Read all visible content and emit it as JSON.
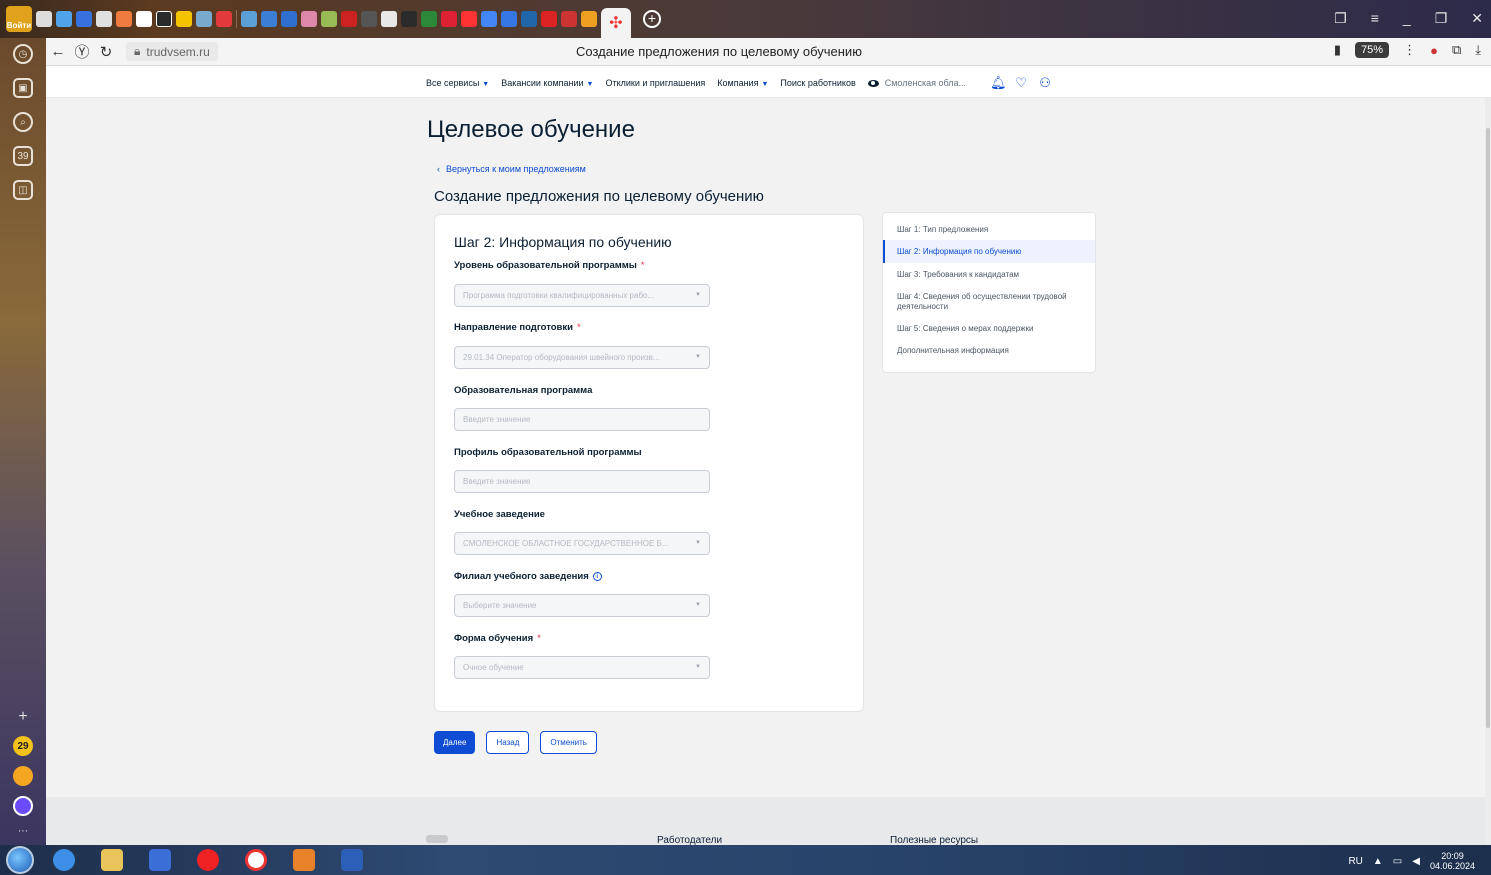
{
  "browser": {
    "login_label": "Войти",
    "url": "trudvsem.ru",
    "page_title": "Создание предложения по целевому обучению",
    "zoom": "75%"
  },
  "header": {
    "nav": [
      {
        "label": "Все сервисы",
        "dropdown": true
      },
      {
        "label": "Вакансии компании",
        "dropdown": true
      },
      {
        "label": "Отклики и приглашения",
        "dropdown": false
      },
      {
        "label": "Компания",
        "dropdown": true
      },
      {
        "label": "Поиск работников",
        "dropdown": false
      }
    ],
    "region": "Смоленская обла..."
  },
  "page": {
    "title": "Целевое обучение",
    "back_link": "Вернуться к моим предложениям",
    "subtitle": "Создание предложения по целевому обучению"
  },
  "form": {
    "step_title": "Шаг 2: Информация по обучению",
    "fields": [
      {
        "label": "Уровень образовательной программы",
        "required": true,
        "info": false,
        "value": "Программа подготовки квалифицированных рабо...",
        "dropdown": true
      },
      {
        "label": "Направление подготовки",
        "required": true,
        "info": false,
        "value": "29.01.34 Оператор оборудования швейного произв...",
        "dropdown": true
      },
      {
        "label": "Образовательная программа",
        "required": false,
        "info": false,
        "value": "Введите значение",
        "dropdown": false
      },
      {
        "label": "Профиль образовательной программы",
        "required": false,
        "info": false,
        "value": "Введите значение",
        "dropdown": false
      },
      {
        "label": "Учебное заведение",
        "required": false,
        "info": false,
        "value": "СМОЛЕНСКОЕ ОБЛАСТНОЕ ГОСУДАРСТВЕННОЕ Б...",
        "dropdown": true
      },
      {
        "label": "Филиал учебного заведения",
        "required": false,
        "info": true,
        "value": "Выберите значение",
        "dropdown": true
      },
      {
        "label": "Форма обучения",
        "required": true,
        "info": false,
        "value": "Очное обучение",
        "dropdown": true
      }
    ]
  },
  "steps": [
    {
      "label": "Шаг 1: Тип предложения",
      "active": false
    },
    {
      "label": "Шаг 2: Информация по обучению",
      "active": true
    },
    {
      "label": "Шаг 3: Требования к кандидатам",
      "active": false
    },
    {
      "label": "Шаг 4: Сведения об осуществлении трудовой деятельности",
      "active": false
    },
    {
      "label": "Шаг 5: Сведения о мерах поддержки",
      "active": false
    },
    {
      "label": "Дополнительная информация",
      "active": false
    }
  ],
  "buttons": {
    "next": "Далее",
    "back": "Назад",
    "cancel": "Отменить"
  },
  "footer": {
    "col1": "Работодатели",
    "col2": "Полезные ресурсы"
  },
  "sidebar": {
    "badge_count": "29",
    "calendar_day": "39"
  },
  "taskbar": {
    "lang": "RU",
    "time": "20:09",
    "date": "04.06.2024"
  },
  "colors": {
    "accent": "#0d4cd3",
    "required": "#e1344a"
  }
}
